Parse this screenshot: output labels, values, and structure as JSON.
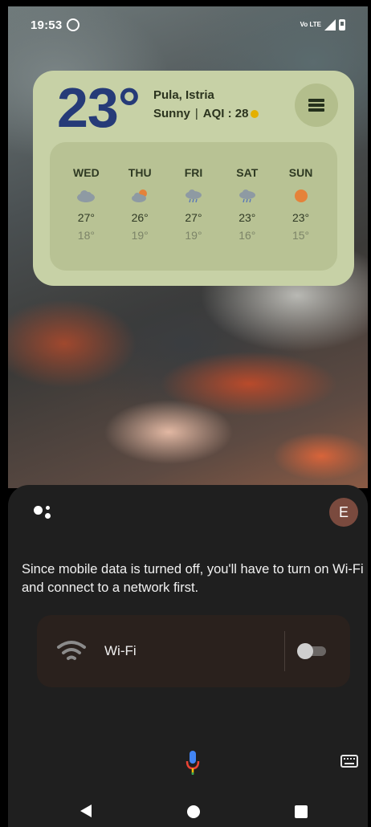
{
  "status_bar": {
    "time": "19:53",
    "notification_icon": "whatsapp-icon",
    "network_label": "Vo LTE",
    "signal_icon": "signal-icon",
    "battery_icon": "battery-icon"
  },
  "weather": {
    "temperature": "23°",
    "location": "Pula, Istria",
    "condition": "Sunny",
    "separator": "|",
    "aqi_label": "AQI : 28",
    "aqi_color": "#e4b000",
    "menu_icon": "menu-icon",
    "forecast": [
      {
        "day": "WED",
        "icon": "cloudy-icon",
        "high": "27°",
        "low": "18°"
      },
      {
        "day": "THU",
        "icon": "partly-cloudy-icon",
        "high": "26°",
        "low": "19°"
      },
      {
        "day": "FRI",
        "icon": "rain-icon",
        "high": "27°",
        "low": "19°"
      },
      {
        "day": "SAT",
        "icon": "rain-icon",
        "high": "23°",
        "low": "16°"
      },
      {
        "day": "SUN",
        "icon": "sunny-icon",
        "high": "23°",
        "low": "15°"
      }
    ]
  },
  "assistant": {
    "avatar_initial": "E",
    "message": "Since mobile data is turned off, you'll have to turn on Wi-Fi and connect to a network first.",
    "wifi_label": "Wi-Fi",
    "wifi_enabled": false,
    "mic_icon": "mic-icon",
    "keyboard_icon": "keyboard-icon"
  },
  "nav_bar": {
    "back_icon": "back-icon",
    "home_icon": "home-icon",
    "recents_icon": "recents-icon"
  },
  "colors": {
    "widget_bg": "#c7d1a6",
    "temperature": "#263b78",
    "panel_bg": "#1f1f1f",
    "avatar_bg": "#7a4a3e"
  }
}
